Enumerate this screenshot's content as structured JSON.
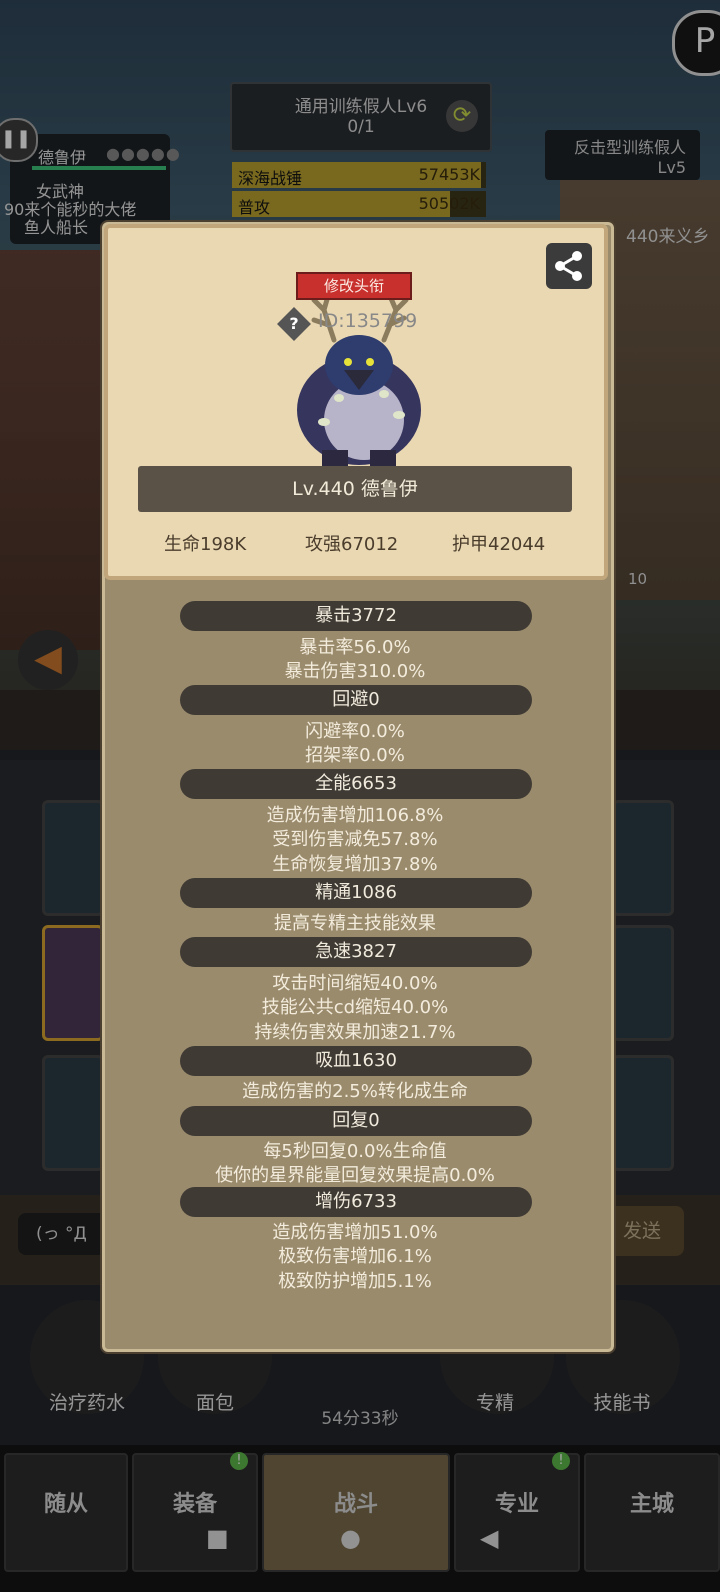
{
  "hud": {
    "dummy_title": "通用训练假人Lv6",
    "dummy_progress": "0/1",
    "damage_rows": [
      {
        "name": "深海战锤",
        "value": "57453K",
        "fill": 0.98
      },
      {
        "name": "普攻",
        "value": "50502K",
        "fill": 0.86
      }
    ],
    "player": {
      "name": "德鲁伊",
      "dots": "●●●●●",
      "title1": "女武神",
      "title2": "90来个能秒的大佬",
      "title3": "鱼人船长"
    },
    "enemy": {
      "line1": "反击型训练假人",
      "line2": "Lv5"
    },
    "enemy_label": "440来义乡",
    "level_tag": "10",
    "input_text": "(っ °Д",
    "send_label": "发送",
    "items": [
      "治疗药水",
      "面包",
      "专精",
      "技能书"
    ],
    "timer": "54分33秒",
    "nav": [
      "随从",
      "装备",
      "战斗",
      "专业",
      "主城"
    ],
    "badge": "!"
  },
  "card": {
    "change_title_label": "修改头衔",
    "help_label": "?",
    "uid": "ID:135799",
    "name": "Lv.440 德鲁伊",
    "hp": "生命198K",
    "attack": "攻强67012",
    "armor": "护甲42044"
  },
  "stats": [
    {
      "head": "暴击3772",
      "lines": [
        "暴击率56.0%",
        "暴击伤害310.0%"
      ]
    },
    {
      "head": "回避0",
      "lines": [
        "闪避率0.0%",
        "招架率0.0%"
      ]
    },
    {
      "head": "全能6653",
      "lines": [
        "造成伤害增加106.8%",
        "受到伤害减免57.8%",
        "生命恢复增加37.8%"
      ]
    },
    {
      "head": "精通1086",
      "lines": [
        "提高专精主技能效果"
      ]
    },
    {
      "head": "急速3827",
      "lines": [
        "攻击时间缩短40.0%",
        "技能公共cd缩短40.0%",
        "持续伤害效果加速21.7%"
      ]
    },
    {
      "head": "吸血1630",
      "lines": [
        "造成伤害的2.5%转化成生命"
      ]
    },
    {
      "head": "回复0",
      "lines": [
        "每5秒回复0.0%生命值",
        "使你的星界能量回复效果提高0.0%"
      ]
    },
    {
      "head": "增伤6733",
      "lines": [
        "造成伤害增加51.0%",
        "极致伤害增加6.1%",
        "极致防护增加5.1%"
      ]
    }
  ],
  "colors": {
    "accent_red": "#c8302e",
    "panel": "#9b8b6d",
    "portrait_bg": "#ead8b3",
    "section_head": "#3f3a34",
    "hp_green": "#3dc27a",
    "damage_bar": "#b9a131"
  }
}
